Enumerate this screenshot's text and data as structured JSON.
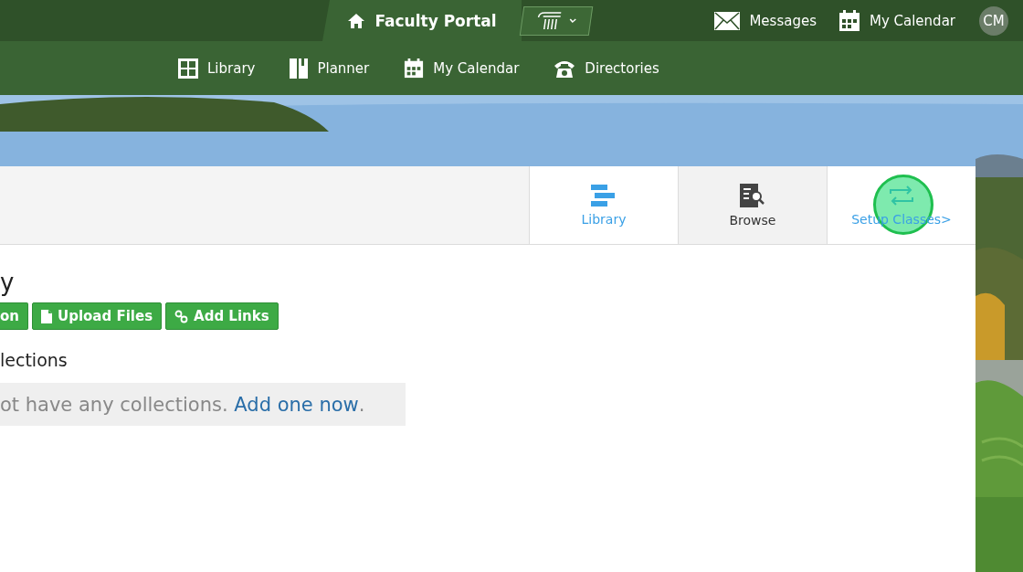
{
  "top_bar": {
    "portal_title": "Faculty Portal",
    "links": [
      {
        "kind": "mail",
        "label": "Messages"
      },
      {
        "kind": "calendar",
        "label": "My Calendar"
      }
    ],
    "avatar": "CM"
  },
  "nav": [
    {
      "kind": "grid",
      "label": "Library"
    },
    {
      "kind": "book",
      "label": "Planner"
    },
    {
      "kind": "calendar",
      "label": "My Calendar"
    },
    {
      "kind": "phone",
      "label": "Directories"
    }
  ],
  "tabs": [
    {
      "kind": "library",
      "label": "Library",
      "selected": false,
      "highlighted": false
    },
    {
      "kind": "browse",
      "label": "Browse",
      "selected": true,
      "highlighted": false
    },
    {
      "kind": "setup",
      "label": "Setup Classes>",
      "selected": false,
      "highlighted": true
    }
  ],
  "heading": "y",
  "buttons": [
    {
      "kind": "none",
      "label": "on"
    },
    {
      "kind": "file",
      "label": "Upload Files"
    },
    {
      "kind": "link",
      "label": "Add Links"
    }
  ],
  "section_title": "lections",
  "empty_message": {
    "text": "ot have any collections.",
    "link": "Add one now",
    "end": "."
  }
}
